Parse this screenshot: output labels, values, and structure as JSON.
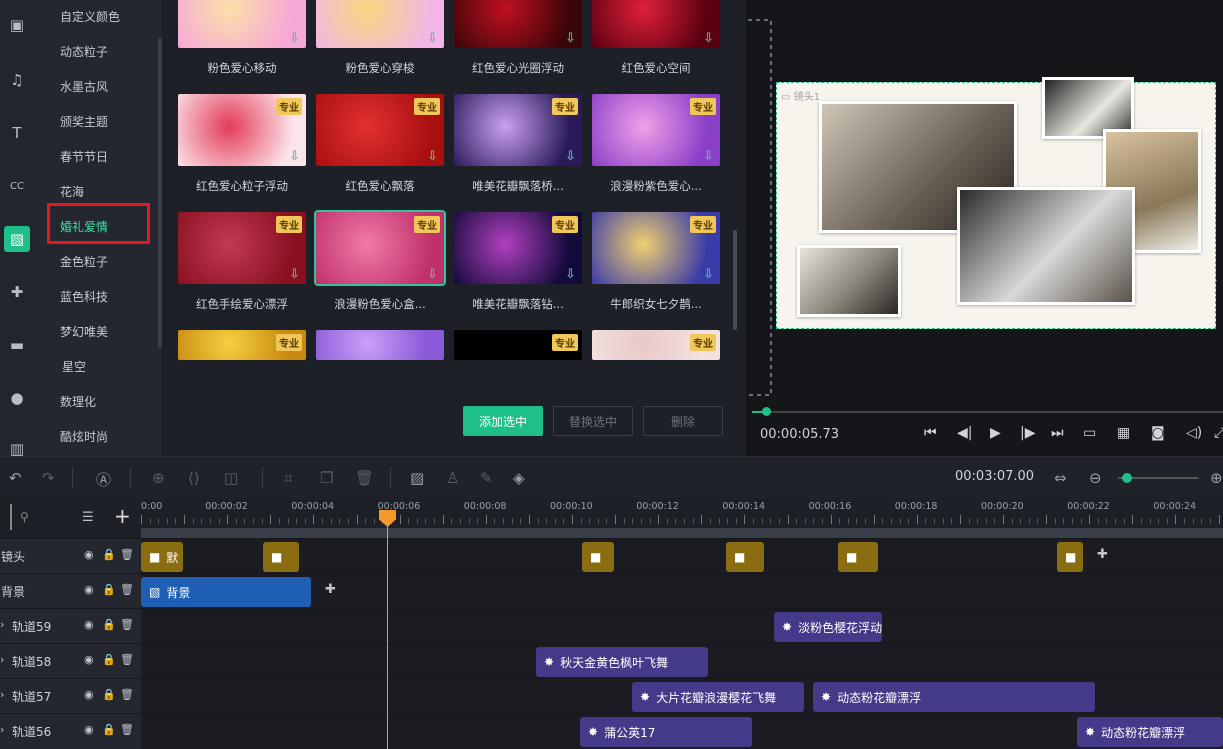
{
  "categories": [
    "自定义颜色",
    "动态粒子",
    "水墨古风",
    "颁奖主题",
    "春节节日",
    "花海",
    "婚礼爱情",
    "金色粒子",
    "蓝色科技",
    "梦幻唯美",
    "星空",
    "数理化",
    "酷炫时尚"
  ],
  "templates": [
    {
      "label": "粉色爱心移动",
      "pro": "",
      "c1": "#f7a7d8",
      "c2": "#fbe0a8"
    },
    {
      "label": "粉色爱心穿梭",
      "pro": "",
      "c1": "#f3b6e6",
      "c2": "#f7d77e"
    },
    {
      "label": "红色爱心光圈浮动",
      "pro": "",
      "c1": "#3a0508",
      "c2": "#c01020"
    },
    {
      "label": "红色爱心空间",
      "pro": "",
      "c1": "#5a0010",
      "c2": "#e0203a"
    },
    {
      "label": "红色爱心粒子浮动",
      "pro": "专业",
      "c1": "#fbe4ea",
      "c2": "#e33b58"
    },
    {
      "label": "红色爱心飘落",
      "pro": "专业",
      "c1": "#a81010",
      "c2": "#e33030"
    },
    {
      "label": "唯美花瓣飘落桥...",
      "pro": "专业",
      "c1": "#2a1a5a",
      "c2": "#c9a0f0"
    },
    {
      "label": "浪漫粉紫色爱心...",
      "pro": "专业",
      "c1": "#8a3fc8",
      "c2": "#f0a0e8"
    },
    {
      "label": "红色手绘爱心漂浮",
      "pro": "专业",
      "c1": "#8a1020",
      "c2": "#c23a55"
    },
    {
      "label": "浪漫粉色爱心盒...",
      "pro": "专业",
      "c1": "#c0306a",
      "c2": "#f07aa8"
    },
    {
      "label": "唯美花瓣飘落钻...",
      "pro": "专业",
      "c1": "#120a3a",
      "c2": "#b040c0"
    },
    {
      "label": "牛郎织女七夕鹊...",
      "pro": "专业",
      "c1": "#3a3aa8",
      "c2": "#f0d070"
    },
    {
      "label": "",
      "pro": "专业",
      "c1": "#c88a10",
      "c2": "#f6d040"
    },
    {
      "label": "",
      "pro": "",
      "c1": "#8a5ad8",
      "c2": "#c8a0f8"
    },
    {
      "label": "",
      "pro": "专业",
      "c1": "#000000",
      "c2": "#000000"
    },
    {
      "label": "",
      "pro": "专业",
      "c1": "#f3e0e0",
      "c2": "#e8c8c8"
    }
  ],
  "buttons": {
    "add": "添加选中",
    "replace": "替换选中",
    "delete": "删除"
  },
  "preview": {
    "scene_label": "镜头1",
    "time": "00:00:05.73"
  },
  "toolbar": {
    "total_time": "00:03:07.00"
  },
  "ruler": [
    "0:00",
    "00:00:02",
    "00:00:04",
    "00:00:06",
    "00:00:08",
    "00:00:10",
    "00:00:12",
    "00:00:14",
    "00:00:16",
    "00:00:18",
    "00:00:20",
    "00:00:22",
    "00:00:24"
  ],
  "tracks": [
    {
      "name": "镜头"
    },
    {
      "name": "背景"
    },
    {
      "name": "轨道59"
    },
    {
      "name": "轨道58"
    },
    {
      "name": "轨道57"
    },
    {
      "name": "轨道56"
    }
  ],
  "clips": {
    "cam1": "默",
    "bg": "背景",
    "t59": "淡粉色樱花浮动",
    "t58": "秋天金黄色枫叶飞舞",
    "t57a": "大片花瓣浪漫樱花飞舞",
    "t57b": "动态粉花瓣漂浮",
    "t56a": "蒲公英17",
    "t56b": "动态粉花瓣漂浮"
  },
  "colors": {
    "accent": "#1fbf8a",
    "playhead": "#f39a2a",
    "highlight": "#e8161e"
  }
}
